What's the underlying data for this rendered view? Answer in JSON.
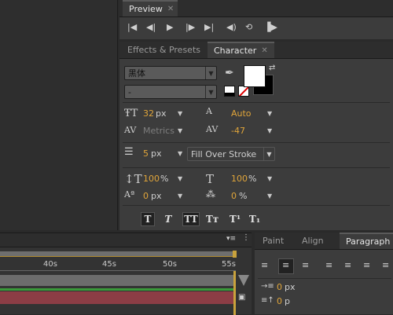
{
  "preview": {
    "tab_label": "Preview",
    "controls": [
      "first-frame-icon",
      "prev-frame-icon",
      "play-icon",
      "next-frame-icon",
      "last-frame-icon",
      "audio-icon",
      "loop-icon",
      "ram-preview-icon"
    ]
  },
  "character": {
    "tabs": [
      {
        "label": "Effects & Presets",
        "active": false
      },
      {
        "label": "Character",
        "active": true
      }
    ],
    "font_family": "黑体",
    "font_style": "-",
    "font_size": "32",
    "font_size_unit": "px",
    "leading": "Auto",
    "kerning": "Metrics",
    "tracking": "-47",
    "stroke_width": "5",
    "stroke_width_unit": "px",
    "stroke_mode": "Fill Over Stroke",
    "vertical_scale": "100",
    "horizontal_scale": "100",
    "scale_unit": "%",
    "baseline_shift": "0",
    "baseline_unit": "px",
    "tsume": "0",
    "tsume_unit": "%",
    "fill_color": "#ffffff",
    "stroke_color": "#000000",
    "style_buttons": [
      "T",
      "T",
      "TT",
      "Tт",
      "T¹",
      "T₁"
    ]
  },
  "timeline": {
    "ticks": [
      "40s",
      "45s",
      "50s",
      "55s"
    ]
  },
  "paragraph": {
    "tabs": [
      {
        "label": "Paint",
        "active": false
      },
      {
        "label": "Align",
        "active": false
      },
      {
        "label": "Paragraph",
        "active": true
      }
    ],
    "indent_left": "0",
    "indent_unit": "px",
    "space_before": "0",
    "space_unit": "p"
  }
}
